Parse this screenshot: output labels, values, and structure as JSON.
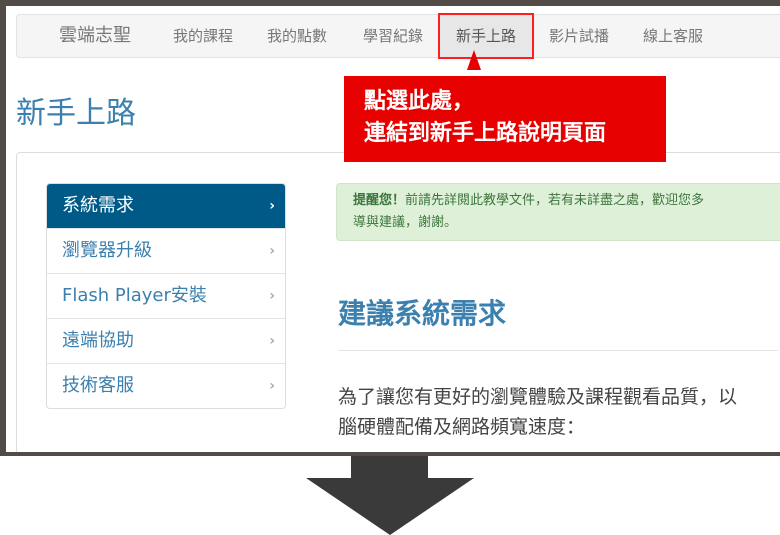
{
  "nav": {
    "brand": "雲端志聖",
    "items": [
      "我的課程",
      "我的點數",
      "學習紀錄",
      "新手上路",
      "影片試播",
      "線上客服"
    ],
    "active": "新手上路"
  },
  "callout": {
    "line1": "點選此處，",
    "line2": "連結到新手上路說明頁面"
  },
  "page": {
    "title": "新手上路"
  },
  "sidebar": {
    "items": [
      "系統需求",
      "瀏覽器升級",
      "Flash Player安裝",
      "遠端協助",
      "技術客服"
    ]
  },
  "alert": {
    "strong": "提醒您！",
    "line1": "前請先詳閱此教學文件，若有未詳盡之處，歡迎您多",
    "line2": "導與建議，謝謝。"
  },
  "section": {
    "heading": "建議系統需求",
    "line1": "為了讓您有更好的瀏覽體驗及課程觀看品質，以",
    "line2": "腦硬體配備及網路頻寬速度："
  },
  "icons": {
    "chevron": "chevron-right-icon",
    "down_arrow": "down-arrow-icon"
  },
  "colors": {
    "accent": "#3b80ae",
    "active_nav": "#005a87",
    "callout": "#e60000",
    "frame": "#534b48",
    "arrow": "#3a3a3a"
  }
}
